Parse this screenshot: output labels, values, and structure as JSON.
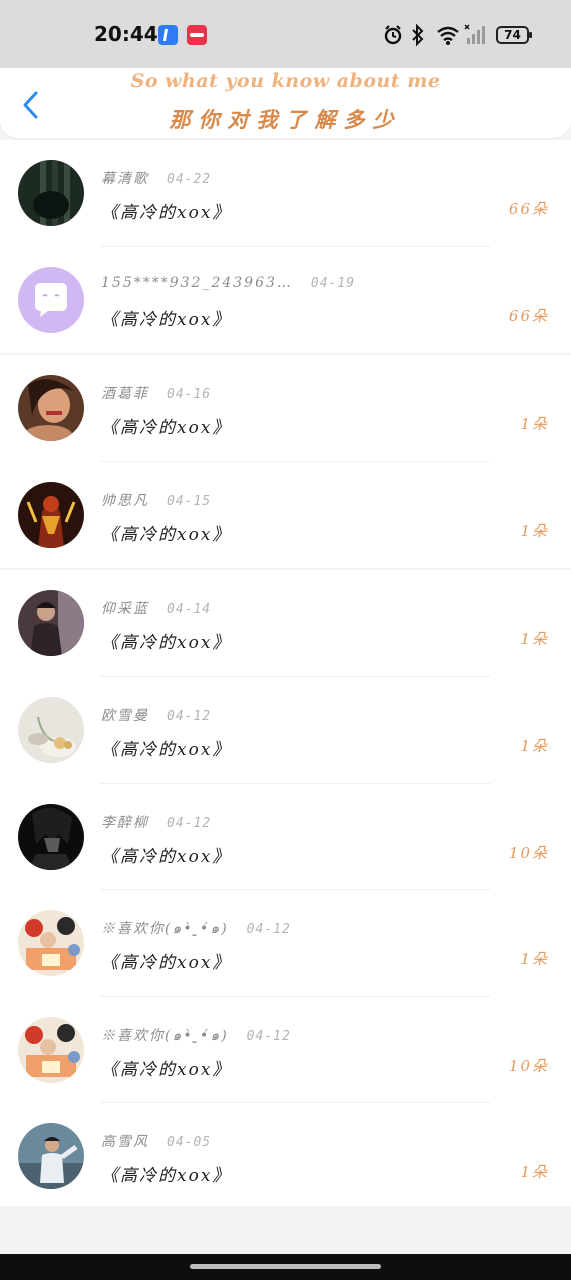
{
  "status_bar": {
    "time": "20:44",
    "battery": "74"
  },
  "header": {
    "title_en": "So what you know about me",
    "title_cn": "那你对我了解多少"
  },
  "items": [
    {
      "name": "幕清歌",
      "date": "04-22",
      "song": "《高冷的xox》",
      "flowers": "66朵",
      "avatar": "dark-bars"
    },
    {
      "name": "155****932_243963…",
      "date": "04-19",
      "song": "《高冷的xox》",
      "flowers": "66朵",
      "avatar": "purple-chat"
    },
    {
      "name": "酒葛菲",
      "date": "04-16",
      "song": "《高冷的xox》",
      "flowers": "1朵",
      "avatar": "portrait-warm"
    },
    {
      "name": "帅思凡",
      "date": "04-15",
      "song": "《高冷的xox》",
      "flowers": "1朵",
      "avatar": "fire-hero"
    },
    {
      "name": "仰采蓝",
      "date": "04-14",
      "song": "《高冷的xox》",
      "flowers": "1朵",
      "avatar": "dusk-person"
    },
    {
      "name": "欧雪曼",
      "date": "04-12",
      "song": "《高冷的xox》",
      "flowers": "1朵",
      "avatar": "flowers-light"
    },
    {
      "name": "李醉柳",
      "date": "04-12",
      "song": "《高冷的xox》",
      "flowers": "10朵",
      "avatar": "dark-anime"
    },
    {
      "name": "※喜欢你(๑•̀ ̫•́๑)",
      "date": "04-12",
      "song": "《高冷的xox》",
      "flowers": "1朵",
      "avatar": "anime-group"
    },
    {
      "name": "※喜欢你(๑•̀ ̫•́๑)",
      "date": "04-12",
      "song": "《高冷的xox》",
      "flowers": "10朵",
      "avatar": "anime-group"
    },
    {
      "name": "高雪风",
      "date": "04-05",
      "song": "《高冷的xox》",
      "flowers": "1朵",
      "avatar": "street-boy"
    }
  ],
  "colors": {
    "accent_orange": "#e49a5c",
    "back_blue": "#2d8cf0"
  }
}
